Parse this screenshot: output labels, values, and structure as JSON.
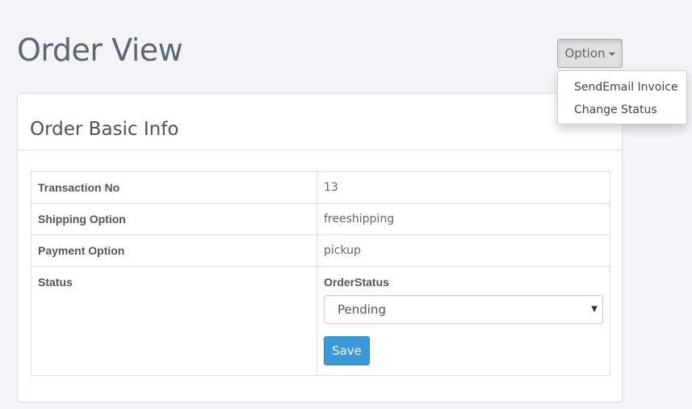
{
  "page": {
    "title": "Order View"
  },
  "option_button": {
    "label": "Option"
  },
  "dropdown": {
    "items": [
      {
        "label": "SendEmail Invoice"
      },
      {
        "label": "Change Status"
      }
    ]
  },
  "panel": {
    "title": "Order Basic Info"
  },
  "table": {
    "rows": [
      {
        "label": "Transaction No",
        "value": "13"
      },
      {
        "label": "Shipping Option",
        "value": "freeshipping"
      },
      {
        "label": "Payment Option",
        "value": "pickup"
      }
    ],
    "status": {
      "label": "Status",
      "field_label": "OrderStatus",
      "selected": "Pending",
      "save_label": "Save"
    }
  }
}
